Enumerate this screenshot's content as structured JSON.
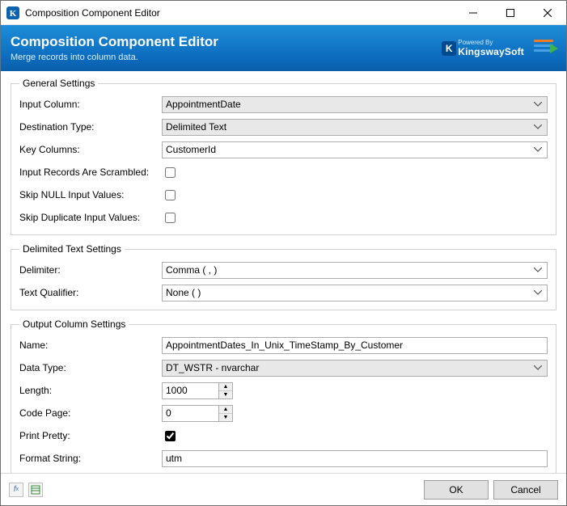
{
  "window": {
    "title": "Composition Component Editor"
  },
  "banner": {
    "title": "Composition Component Editor",
    "subtitle": "Merge records into column data.",
    "powered_by": "Powered By",
    "brand": "KingswaySoft"
  },
  "general": {
    "legend": "General Settings",
    "input_column_label": "Input Column:",
    "input_column_value": "AppointmentDate",
    "destination_type_label": "Destination Type:",
    "destination_type_value": "Delimited Text",
    "key_columns_label": "Key Columns:",
    "key_columns_value": "CustomerId",
    "scrambled_label": "Input Records Are Scrambled:",
    "scrambled_checked": false,
    "skip_null_label": "Skip NULL Input Values:",
    "skip_null_checked": false,
    "skip_dup_label": "Skip Duplicate Input Values:",
    "skip_dup_checked": false
  },
  "delimited": {
    "legend": "Delimited Text Settings",
    "delimiter_label": "Delimiter:",
    "delimiter_value": "Comma ( , )",
    "text_qualifier_label": "Text Qualifier:",
    "text_qualifier_value": "None (  )"
  },
  "output": {
    "legend": "Output Column Settings",
    "name_label": "Name:",
    "name_value": "AppointmentDates_In_Unix_TimeStamp_By_Customer",
    "data_type_label": "Data Type:",
    "data_type_value": "DT_WSTR - nvarchar",
    "length_label": "Length:",
    "length_value": "1000",
    "code_page_label": "Code Page:",
    "code_page_value": "0",
    "print_pretty_label": "Print Pretty:",
    "print_pretty_checked": true,
    "format_string_label": "Format String:",
    "format_string_value": "utm"
  },
  "footer": {
    "ok": "OK",
    "cancel": "Cancel"
  }
}
